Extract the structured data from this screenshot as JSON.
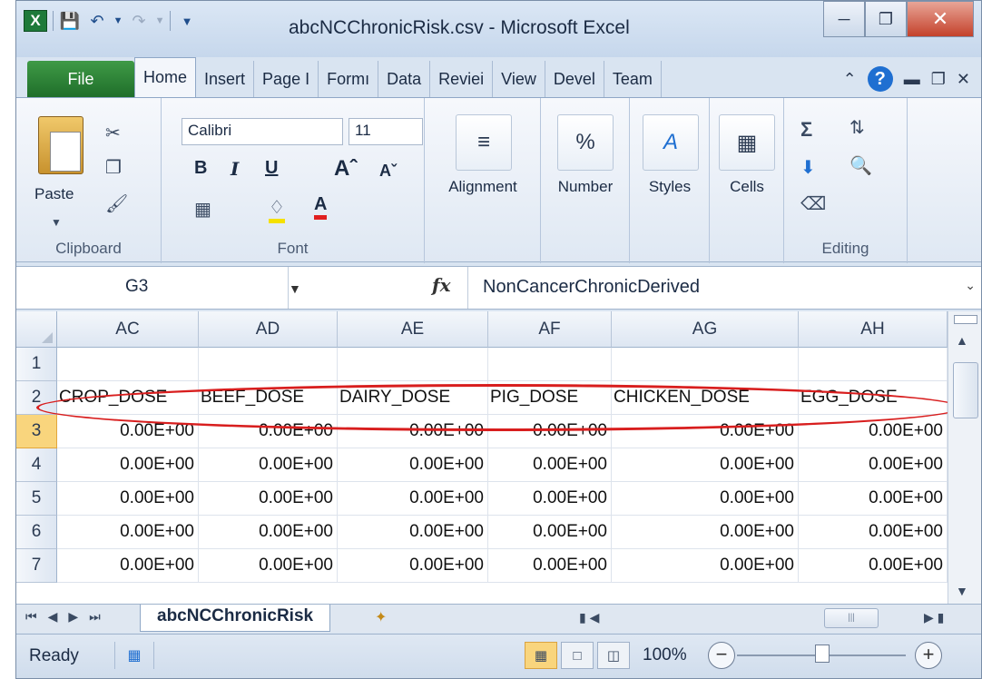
{
  "window": {
    "title": "abcNCChronicRisk.csv - Microsoft Excel",
    "app_icon": "excel-icon"
  },
  "ribbon_tabs": [
    "File",
    "Home",
    "Insert",
    "Page I",
    "Formı",
    "Data",
    "Reviei",
    "View",
    "Devel",
    "Team"
  ],
  "ribbon": {
    "clipboard": {
      "label": "Clipboard",
      "paste_label": "Paste"
    },
    "font": {
      "label": "Font",
      "font_name": "Calibri",
      "font_size": "11"
    },
    "alignment": {
      "label": "Alignment"
    },
    "number": {
      "label": "Number"
    },
    "styles": {
      "label": "Styles"
    },
    "cells": {
      "label": "Cells"
    },
    "editing": {
      "label": "Editing"
    }
  },
  "formula_bar": {
    "name_box": "G3",
    "fx": "fx",
    "content": "NonCancerChronicDerived"
  },
  "columns": [
    "AC",
    "AD",
    "AE",
    "AF",
    "AG",
    "AH"
  ],
  "rows": [
    "1",
    "2",
    "3",
    "4",
    "5",
    "6",
    "7"
  ],
  "header_row": [
    "CROP_DOSE",
    "BEEF_DOSE",
    "DAIRY_DOSE",
    "PIG_DOSE",
    "CHICKEN_DOSE",
    "EGG_DOSE"
  ],
  "data_rows": [
    [
      "0.00E+00",
      "0.00E+00",
      "0.00E+00",
      "0.00E+00",
      "0.00E+00",
      "0.00E+00"
    ],
    [
      "0.00E+00",
      "0.00E+00",
      "0.00E+00",
      "0.00E+00",
      "0.00E+00",
      "0.00E+00"
    ],
    [
      "0.00E+00",
      "0.00E+00",
      "0.00E+00",
      "0.00E+00",
      "0.00E+00",
      "0.00E+00"
    ],
    [
      "0.00E+00",
      "0.00E+00",
      "0.00E+00",
      "0.00E+00",
      "0.00E+00",
      "0.00E+00"
    ],
    [
      "0.00E+00",
      "0.00E+00",
      "0.00E+00",
      "0.00E+00",
      "0.00E+00",
      "0.00E+00"
    ]
  ],
  "sheet_tab": "abcNCChronicRisk",
  "status": {
    "ready": "Ready",
    "zoom": "100%"
  },
  "colors": {
    "file_tab": "#2a7d33",
    "annotation": "#d81e1e",
    "selected_row_header": "#f9d57d"
  }
}
